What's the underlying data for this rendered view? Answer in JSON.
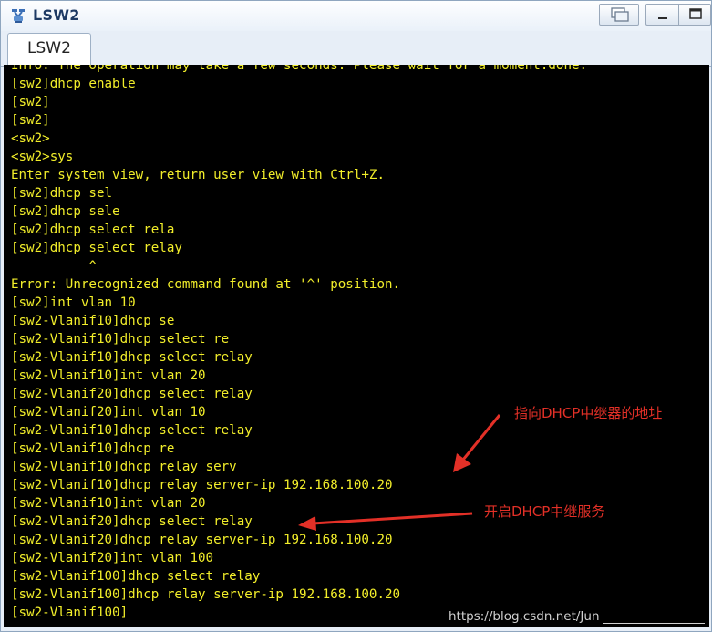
{
  "window": {
    "title": "LSW2"
  },
  "tab": {
    "label": "LSW2"
  },
  "terminal": {
    "lines": [
      "Info: The operation may take a few seconds. Please wait for a moment.done.",
      "[sw2]dhcp enable",
      "[sw2]",
      "[sw2]",
      "<sw2>",
      "<sw2>sys",
      "Enter system view, return user view with Ctrl+Z.",
      "[sw2]dhcp sel",
      "[sw2]dhcp sele",
      "[sw2]dhcp select rela",
      "[sw2]dhcp select relay",
      "          ^",
      "Error: Unrecognized command found at '^' position.",
      "[sw2]int vlan 10",
      "[sw2-Vlanif10]dhcp se",
      "[sw2-Vlanif10]dhcp select re",
      "[sw2-Vlanif10]dhcp select relay",
      "[sw2-Vlanif10]int vlan 20",
      "[sw2-Vlanif20]dhcp select relay",
      "[sw2-Vlanif20]int vlan 10",
      "[sw2-Vlanif10]dhcp select relay",
      "[sw2-Vlanif10]dhcp re",
      "[sw2-Vlanif10]dhcp relay serv",
      "[sw2-Vlanif10]dhcp relay server-ip 192.168.100.20",
      "[sw2-Vlanif10]int vlan 20",
      "[sw2-Vlanif20]dhcp select relay",
      "[sw2-Vlanif20]dhcp relay server-ip 192.168.100.20",
      "[sw2-Vlanif20]int vlan 100",
      "[sw2-Vlanif100]dhcp select relay",
      "[sw2-Vlanif100]dhcp relay server-ip 192.168.100.20",
      "[sw2-Vlanif100]"
    ]
  },
  "annotations": {
    "relay_address": "指向DHCP中继器的地址",
    "enable_relay": "开启DHCP中继服务"
  },
  "watermark": "https://blog.csdn.net/Jun",
  "colors": {
    "terminal_bg": "#000000",
    "terminal_text": "#f2ee2a",
    "annotation": "#e33027"
  }
}
